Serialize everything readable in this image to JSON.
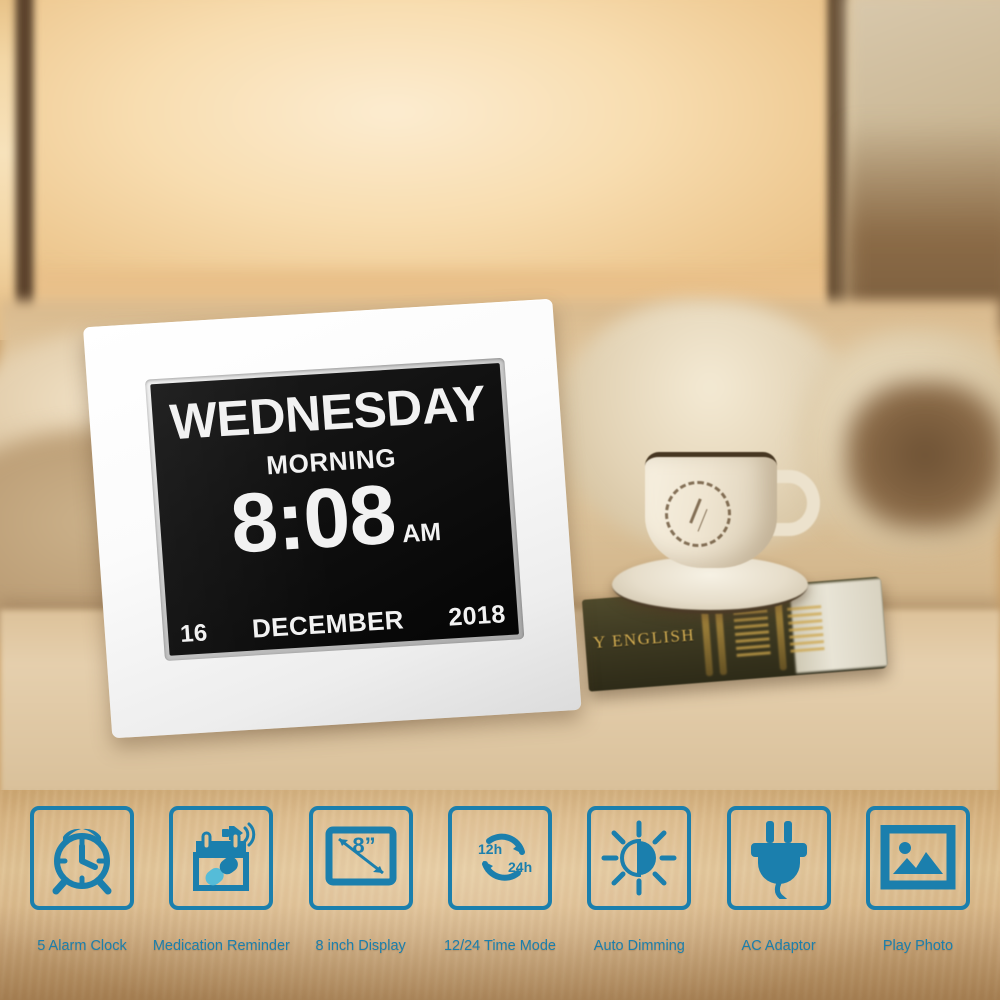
{
  "scene": {
    "description": "Digital day clock product photo on bedside table",
    "surface_color": "#d9b684",
    "accent_color": "#1b7fad",
    "accent_color_light": "#55bcd8"
  },
  "props": {
    "book": {
      "spine_text": "Y ENGLISH",
      "color": "#3e3a22",
      "foil_color": "#d8b153"
    },
    "cup": {
      "name": "coffee-cup",
      "color": "#f2e9d6",
      "stamp": "clock-face-stamp"
    }
  },
  "clock": {
    "frame_color": "#ffffff",
    "screen_color": "#0a0a0a",
    "text_color": "#f2f2f2",
    "display": {
      "weekday": "WEDNESDAY",
      "period": "MORNING",
      "time": "8:08",
      "ampm": "AM",
      "day": "16",
      "month": "DECEMBER",
      "year": "2018"
    }
  },
  "features": [
    {
      "icon": "alarm-clock-icon",
      "label": "5 Alarm Clock"
    },
    {
      "icon": "medication-calendar-icon",
      "label": "Medication Reminder"
    },
    {
      "icon": "screen-size-icon",
      "label": "8 inch Display",
      "size_label": "8”"
    },
    {
      "icon": "time-mode-cycle-icon",
      "label": "12/24 Time Mode",
      "mode_a": "12h",
      "mode_b": "24h"
    },
    {
      "icon": "auto-dimming-sun-icon",
      "label": "Auto Dimming"
    },
    {
      "icon": "ac-plug-icon",
      "label": "AC Adaptor"
    },
    {
      "icon": "photo-frame-icon",
      "label": "Play Photo"
    }
  ]
}
